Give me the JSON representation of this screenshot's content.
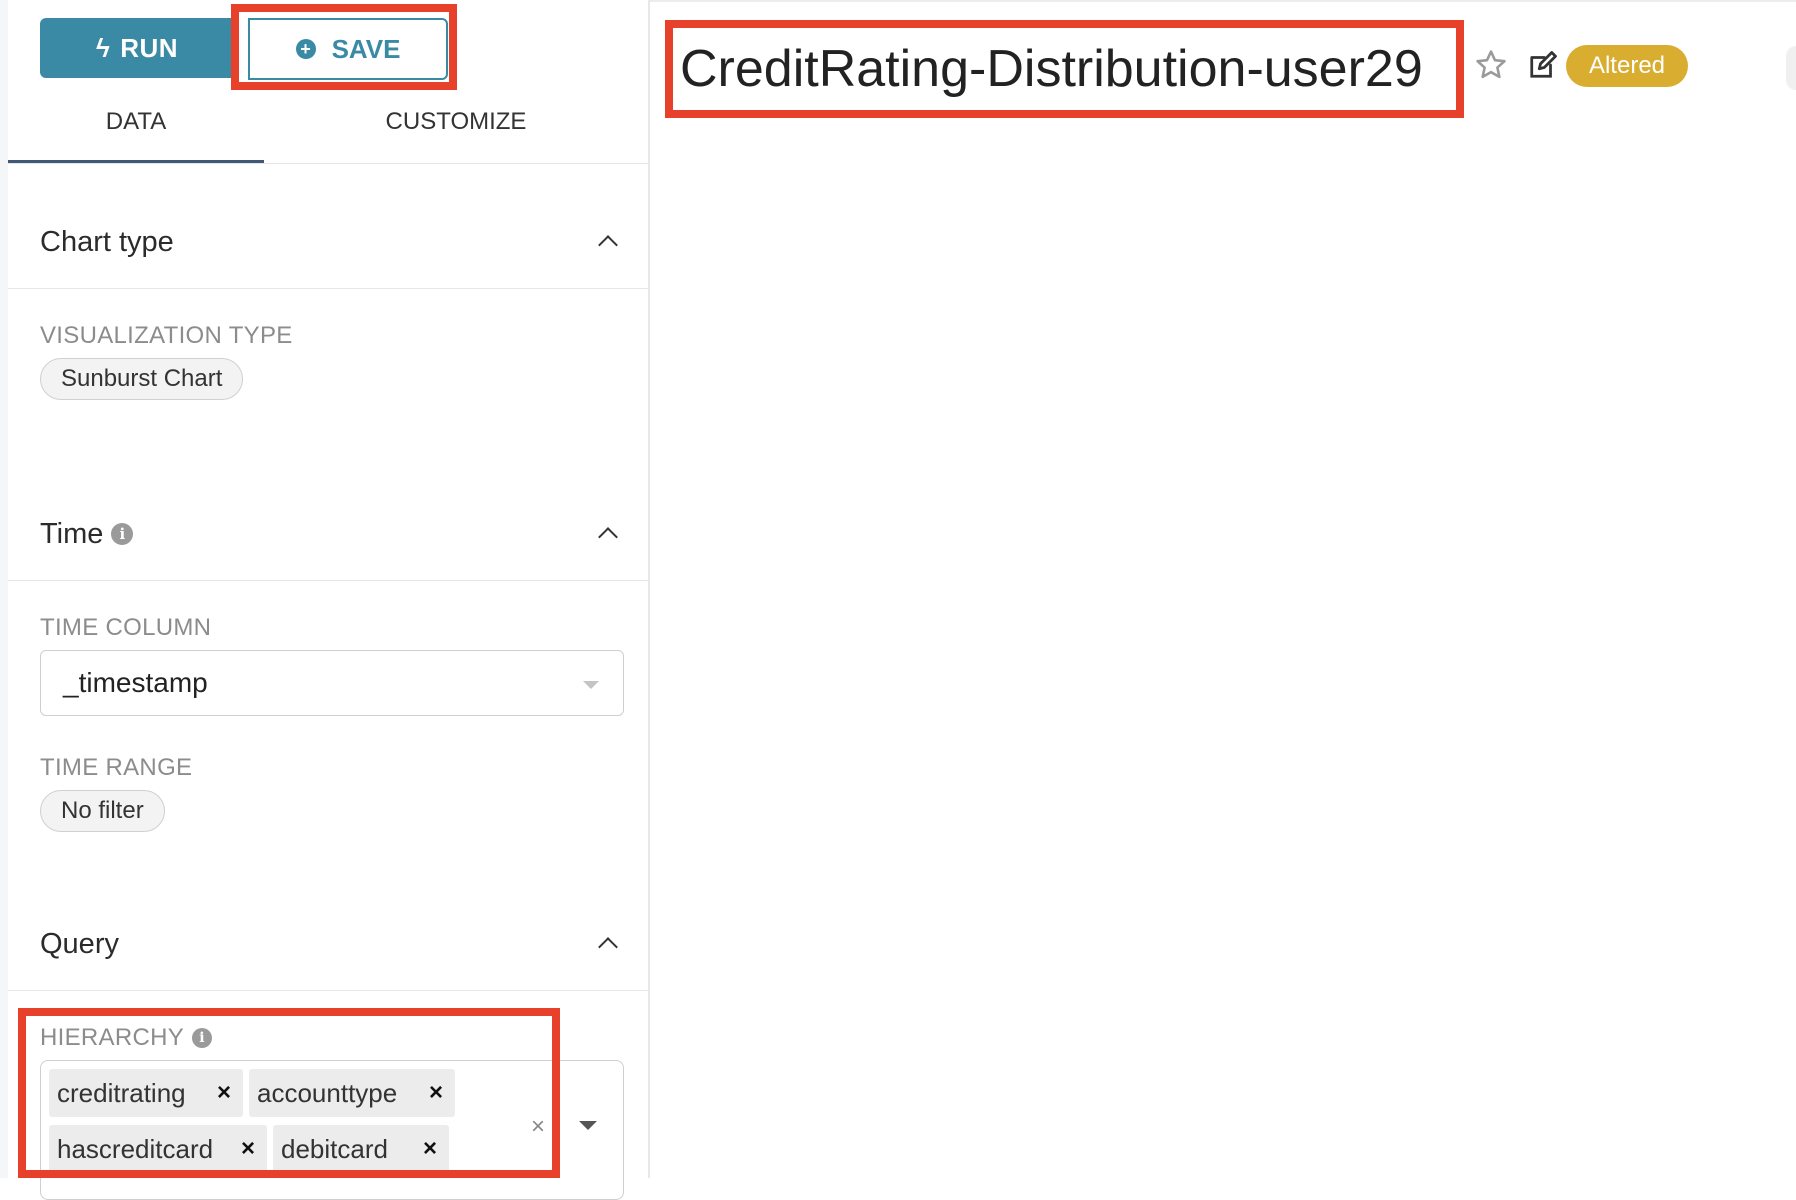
{
  "toolbar": {
    "run_label": "RUN",
    "save_label": "SAVE"
  },
  "tabs": [
    {
      "label": "DATA",
      "active": true
    },
    {
      "label": "CUSTOMIZE",
      "active": false
    }
  ],
  "sections": {
    "chart_type": {
      "title": "Chart type",
      "visualization_type_label": "VISUALIZATION TYPE",
      "visualization_type_value": "Sunburst Chart"
    },
    "time": {
      "title": "Time",
      "time_column_label": "TIME COLUMN",
      "time_column_value": "_timestamp",
      "time_range_label": "TIME RANGE",
      "time_range_value": "No filter"
    },
    "query": {
      "title": "Query",
      "hierarchy_label": "HIERARCHY",
      "hierarchy_values": [
        "creditrating",
        "accounttype",
        "hascreditcard",
        "debitcard"
      ]
    }
  },
  "header": {
    "chart_title": "CreditRating-Distribution-user29",
    "status_badge": "Altered"
  },
  "colors": {
    "primary": "#3b8aa5",
    "highlight": "#e8412b",
    "badge": "#d9ad2f",
    "tab_underline": "#3f5876"
  },
  "icons": [
    "bolt-icon",
    "plus-circle-icon",
    "chevron-up-icon",
    "info-icon",
    "caret-down-icon",
    "close-icon",
    "star-icon",
    "edit-icon"
  ]
}
